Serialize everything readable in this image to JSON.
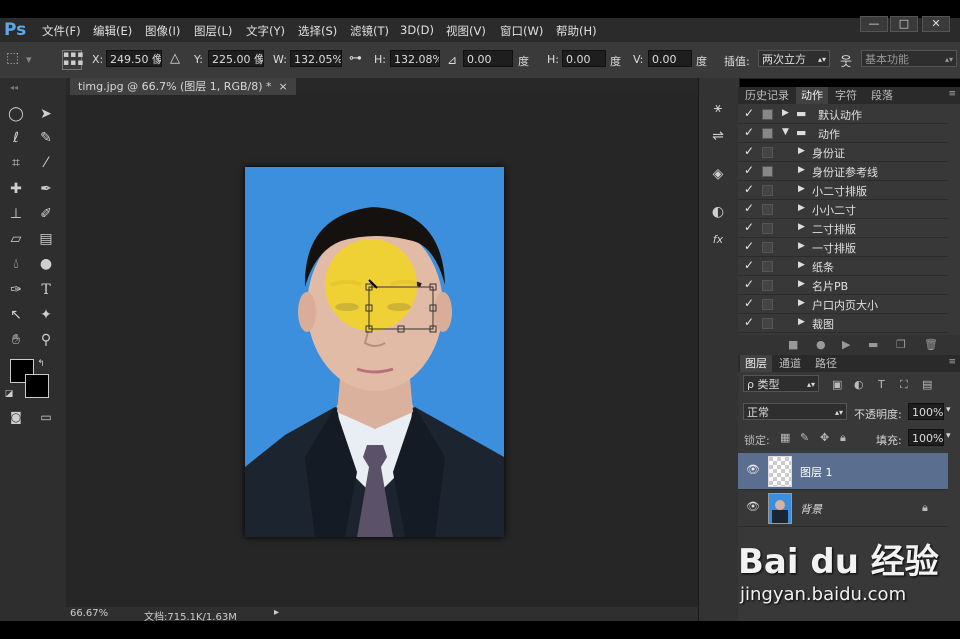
{
  "app": {
    "logo": "Ps"
  },
  "menu": [
    "文件(F)",
    "编辑(E)",
    "图像(I)",
    "图层(L)",
    "文字(Y)",
    "选择(S)",
    "滤镜(T)",
    "3D(D)",
    "视图(V)",
    "窗口(W)",
    "帮助(H)"
  ],
  "window_buttons": [
    "—",
    "□",
    "✕"
  ],
  "options": {
    "x_label": "X:",
    "x_value": "249.50 像素",
    "y_label": "Y:",
    "y_value": "225.00 像素",
    "w_label": "W:",
    "w_value": "132.05%",
    "h_label": "H:",
    "h_value": "132.08%",
    "angle_value": "0.00",
    "angle_unit": "度",
    "hskew_label": "H:",
    "hskew_value": "0.00",
    "hskew_unit": "度",
    "vskew_label": "V:",
    "vskew_value": "0.00",
    "vskew_unit": "度",
    "interp_label": "插值:",
    "interp_value": "两次立方",
    "workspace": "基本功能"
  },
  "document": {
    "tab": "timg.jpg @ 66.7% (图层 1, RGB/8) *",
    "tab_close": "×",
    "zoom": "66.67%",
    "doc_size": "文档:715.1K/1.63M"
  },
  "actions_panel": {
    "tabs": [
      "历史记录",
      "动作",
      "字符",
      "段落"
    ],
    "active_tab": "动作",
    "items": [
      {
        "label": "默认动作",
        "type": "set"
      },
      {
        "label": "动作",
        "type": "set-open"
      },
      {
        "label": "身份证",
        "type": "action"
      },
      {
        "label": "身份证参考线",
        "type": "action"
      },
      {
        "label": "小二寸排版",
        "type": "action"
      },
      {
        "label": "小小二寸",
        "type": "action"
      },
      {
        "label": "二寸排版",
        "type": "action"
      },
      {
        "label": "一寸排版",
        "type": "action"
      },
      {
        "label": "纸条",
        "type": "action"
      },
      {
        "label": "名片PB",
        "type": "action"
      },
      {
        "label": "户口内页大小",
        "type": "action"
      },
      {
        "label": "裁图",
        "type": "action"
      }
    ]
  },
  "layers_panel": {
    "tabs": [
      "图层",
      "通道",
      "路径"
    ],
    "active_tab": "图层",
    "filter_label": "ρ 类型",
    "blend_mode": "正常",
    "opacity_label": "不透明度:",
    "opacity_value": "100%",
    "lock_label": "锁定:",
    "fill_label": "填充:",
    "fill_value": "100%",
    "layers": [
      {
        "name": "图层 1",
        "selected": true
      },
      {
        "name": "背景",
        "locked": true
      }
    ]
  },
  "watermark": {
    "brand": "Bai du 经验",
    "url": "jingyan.baidu.com"
  },
  "colors": {
    "accent_blue": "#3b8fdc",
    "yellow_brush": "#f0d22e",
    "selected_layer": "#5a6f8f"
  }
}
